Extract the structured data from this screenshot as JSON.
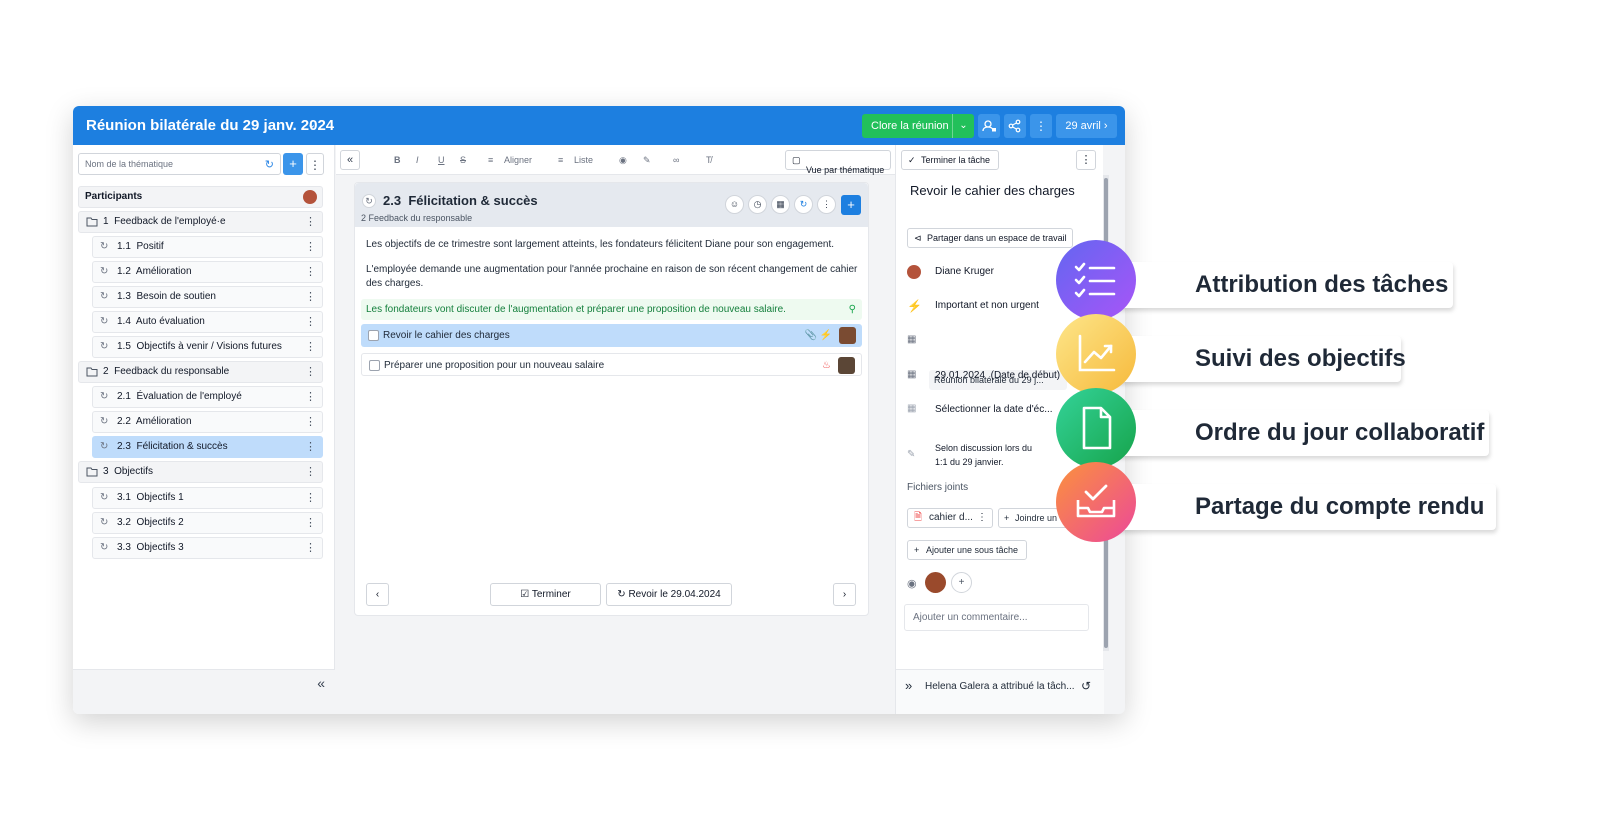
{
  "window": {
    "title": "Réunion bilatérale du 29 janv. 2024",
    "close_meeting": "Clore la réunion",
    "date_nav": "29 avril"
  },
  "sidebar": {
    "search_placeholder": "Nom de la thématique",
    "participants_label": "Participants",
    "sections": [
      {
        "number": "1",
        "label": "Feedback de l'employé·e",
        "items": [
          {
            "number": "1.1",
            "label": "Positif"
          },
          {
            "number": "1.2",
            "label": "Amélioration"
          },
          {
            "number": "1.3",
            "label": "Besoin de soutien"
          },
          {
            "number": "1.4",
            "label": "Auto évaluation"
          },
          {
            "number": "1.5",
            "label": "Objectifs à venir / Visions futures"
          }
        ]
      },
      {
        "number": "2",
        "label": "Feedback du responsable",
        "items": [
          {
            "number": "2.1",
            "label": "Évaluation de l'employé"
          },
          {
            "number": "2.2",
            "label": "Amélioration"
          },
          {
            "number": "2.3",
            "label": "Félicitation & succès"
          }
        ]
      },
      {
        "number": "3",
        "label": "Objectifs",
        "items": [
          {
            "number": "3.1",
            "label": "Objectifs 1"
          },
          {
            "number": "3.2",
            "label": "Objectifs 2"
          },
          {
            "number": "3.3",
            "label": "Objectifs 3"
          }
        ]
      }
    ]
  },
  "toolbar": {
    "align": "Aligner",
    "list": "Liste",
    "view_by_topic": "Vue par thématique"
  },
  "topic": {
    "number": "2.3",
    "title": "Félicitation & succès",
    "parent": "2 Feedback du responsable",
    "paragraphs": [
      "Les objectifs de ce trimestre sont largement atteints, les fondateurs félicitent Diane pour son engagement.",
      "L'employée demande une augmentation pour l'année prochaine en raison de son récent changement de cahier des charges."
    ],
    "highlight": "Les fondateurs vont discuter de l'augmentation et préparer une proposition de nouveau salaire.",
    "tasks": [
      {
        "label": "Revoir le cahier des charges"
      },
      {
        "label": "Préparer une proposition pour un nouveau salaire"
      }
    ],
    "finish_button": "Terminer",
    "review_button": "Revoir le 29.04.2024"
  },
  "task_panel": {
    "finish_task": "Terminer la tâche",
    "title": "Revoir le cahier des charges",
    "share": "Partager dans un espace de travail",
    "assignee": "Diane Kruger",
    "priority": "Important et non urgent",
    "meeting": "Réunion bilatérale du 29 j...",
    "start_date": "29.01.2024",
    "start_date_label": "(Date de début)",
    "due_date": "Sélectionner la date d'éc...",
    "note_line1": "Selon discussion lors du",
    "note_line2": "1:1 du 29 janvier.",
    "files_label": "Fichiers joints",
    "file_name": "cahier d...",
    "join": "Joindre un",
    "add_subtask": "Ajouter une sous tâche",
    "comment_placeholder": "Ajouter un commentaire...",
    "activity": "Helena Galera a attribué la tâch..."
  },
  "features": [
    {
      "label": "Attribution des tâches",
      "color": "#8b5cf6"
    },
    {
      "label": "Suivi des objectifs",
      "color": "#fbbf24"
    },
    {
      "label": "Ordre du jour collaboratif",
      "color": "#22c55e"
    },
    {
      "label": "Partage du compte rendu",
      "color": "#ef4444"
    }
  ]
}
